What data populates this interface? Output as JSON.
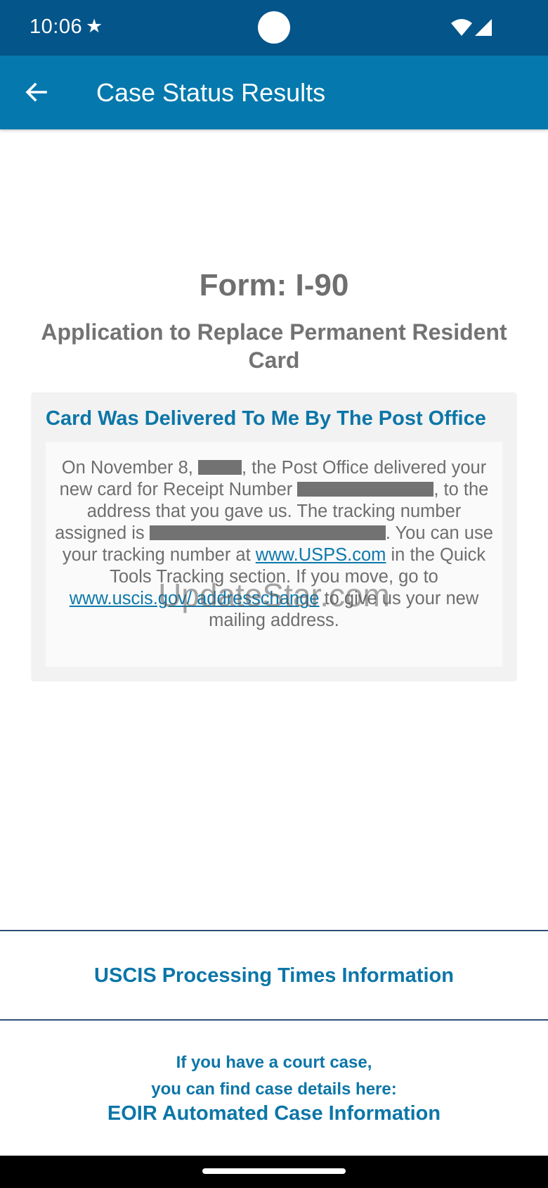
{
  "status_bar": {
    "time": "10:06",
    "star_icon": "★",
    "icons": [
      "star-icon",
      "wifi-icon",
      "signal-icon"
    ],
    "background": "#03558a"
  },
  "app_bar": {
    "title": "Case Status Results",
    "back_icon": "arrow-left-icon",
    "background": "#0579ad"
  },
  "form": {
    "title": "Form: I-90",
    "subtitle": "Application to Replace Permanent Resident Card"
  },
  "status_card": {
    "heading": "Card Was Delivered To Me By The Post Office",
    "body": {
      "part1": "On November 8,",
      "part2": ", the Post Office delivered your new card for Receipt Number",
      "part3": ", to the address that you gave us. The tracking number assigned is",
      "part4": ". You can use your tracking number at",
      "usps_link": "www.USPS.com",
      "part5": "in the Quick Tools Tracking section. If you move, go to",
      "uscis_link": "www.uscis.gov/ addresschange",
      "part6": "to give us your new mailing address."
    },
    "redacted_fields": [
      "year",
      "receipt-number",
      "tracking-number"
    ]
  },
  "watermark": "UpdateStar.com",
  "links": {
    "processing_times": "USCIS Processing Times Information",
    "court_line1": "If you have a court case,",
    "court_line2": "you can find case details here:",
    "eoir": "EOIR Automated Case Information"
  },
  "colors": {
    "accent": "#0c76a8",
    "text_gray": "#6e6e6e",
    "divider": "#2f4e7a"
  }
}
